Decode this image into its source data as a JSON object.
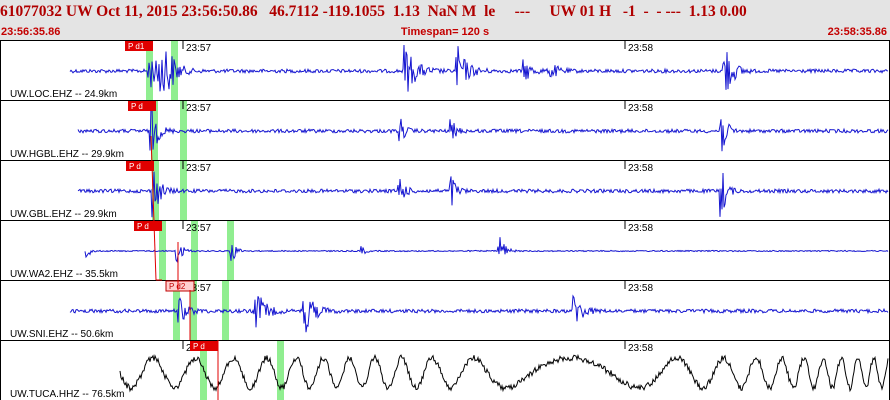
{
  "header": {
    "event_line": "61077032 UW Oct 11, 2015 23:56:50.86   46.7112 -119.1055  1.13  NaN M  le     ---     UW 01 H   -1  -  - ---  1.13 0.00",
    "start_time": "23:56:35.86",
    "timespan": "Timespan= 120 s",
    "end_time": "23:58:35.86"
  },
  "colors": {
    "trace": "#1515d0",
    "pick_box": "#e00000",
    "pick_box_light": "#ffd0d0",
    "window_band": "#90ee90",
    "header_text": "#b00000"
  },
  "time_ticks": [
    "23:57",
    "23:58"
  ],
  "channels": [
    {
      "label": "UW.LOC.EHZ -- 24.9km",
      "pick": "P d1",
      "trace_color": "#1515d0"
    },
    {
      "label": "UW.HGBL.EHZ -- 29.9km",
      "pick": "P d",
      "trace_color": "#1515d0"
    },
    {
      "label": "UW.GBL.EHZ -- 29.9km",
      "pick": "P d",
      "trace_color": "#1515d0"
    },
    {
      "label": "UW.WA2.EHZ -- 35.5km",
      "pick": "P d",
      "trace_color": "#1515d0"
    },
    {
      "label": "UW.SNI.EHZ -- 50.6km",
      "pick": "P d2",
      "trace_color": "#1515d0"
    },
    {
      "label": "UW.TUCA.HHZ -- 76.5km",
      "pick": "P d",
      "trace_color": "#000000"
    }
  ]
}
